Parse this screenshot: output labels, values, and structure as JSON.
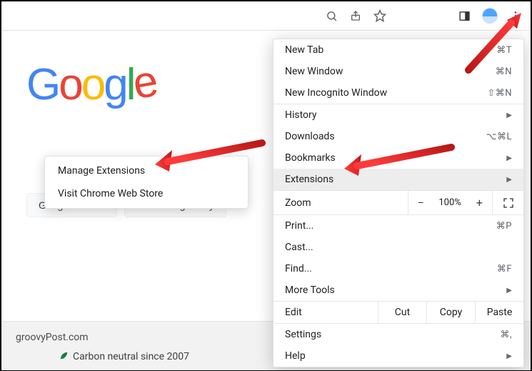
{
  "toolbar": {},
  "logo": {
    "g1": "G",
    "o1": "o",
    "o2": "o",
    "g2": "g",
    "l": "l",
    "e": "e"
  },
  "buttons": {
    "search": "Google Search",
    "lucky": "I'm Feeling Lucky"
  },
  "footer": {
    "brand": "groovyPost.com",
    "carbon": "Carbon neutral since 2007"
  },
  "submenu": {
    "manage": "Manage Extensions",
    "store": "Visit Chrome Web Store"
  },
  "menu": {
    "new_tab": {
      "label": "New Tab",
      "shortcut": "⌘T"
    },
    "new_window": {
      "label": "New Window",
      "shortcut": "⌘N"
    },
    "incognito": {
      "label": "New Incognito Window",
      "shortcut": "⇧⌘N"
    },
    "history": {
      "label": "History"
    },
    "downloads": {
      "label": "Downloads",
      "shortcut": "⌥⌘L"
    },
    "bookmarks": {
      "label": "Bookmarks"
    },
    "extensions": {
      "label": "Extensions"
    },
    "zoom": {
      "label": "Zoom",
      "value": "100%"
    },
    "print": {
      "label": "Print...",
      "shortcut": "⌘P"
    },
    "cast": {
      "label": "Cast..."
    },
    "find": {
      "label": "Find...",
      "shortcut": "⌘F"
    },
    "more_tools": {
      "label": "More Tools"
    },
    "edit": {
      "label": "Edit",
      "cut": "Cut",
      "copy": "Copy",
      "paste": "Paste"
    },
    "settings": {
      "label": "Settings",
      "shortcut": "⌘,"
    },
    "help": {
      "label": "Help"
    }
  }
}
